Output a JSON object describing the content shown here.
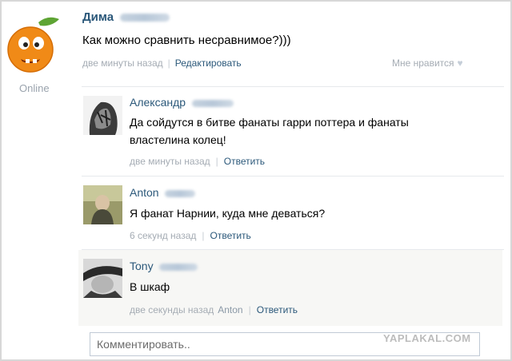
{
  "post": {
    "author": "Дима",
    "status": "Online",
    "text": "Как можно сравнить несравнимое?)))",
    "time": "две минуты назад",
    "edit_label": "Редактировать",
    "like_label": "Мне нравится"
  },
  "comments": [
    {
      "author": "Александр",
      "text_line1": "Да сойдутся в битве фанаты гарри поттера и фанаты",
      "text_line2": "властелина колец!",
      "time": "две минуты назад",
      "reply_label": "Ответить"
    },
    {
      "author": "Anton",
      "text_line1": "Я фанат Нарнии, куда мне деваться?",
      "time": "6 секунд назад",
      "reply_label": "Ответить"
    },
    {
      "author": "Tony",
      "text_line1": "В шкаф",
      "time": "две секунды назад",
      "reply_to": "Anton",
      "reply_label": "Ответить"
    }
  ],
  "comment_input": {
    "placeholder": "Комментировать.."
  },
  "watermark": "YAPLAKAL.COM",
  "colors": {
    "link": "#2b587a",
    "meta": "#a5acb4",
    "divider": "#e6e9ec"
  }
}
